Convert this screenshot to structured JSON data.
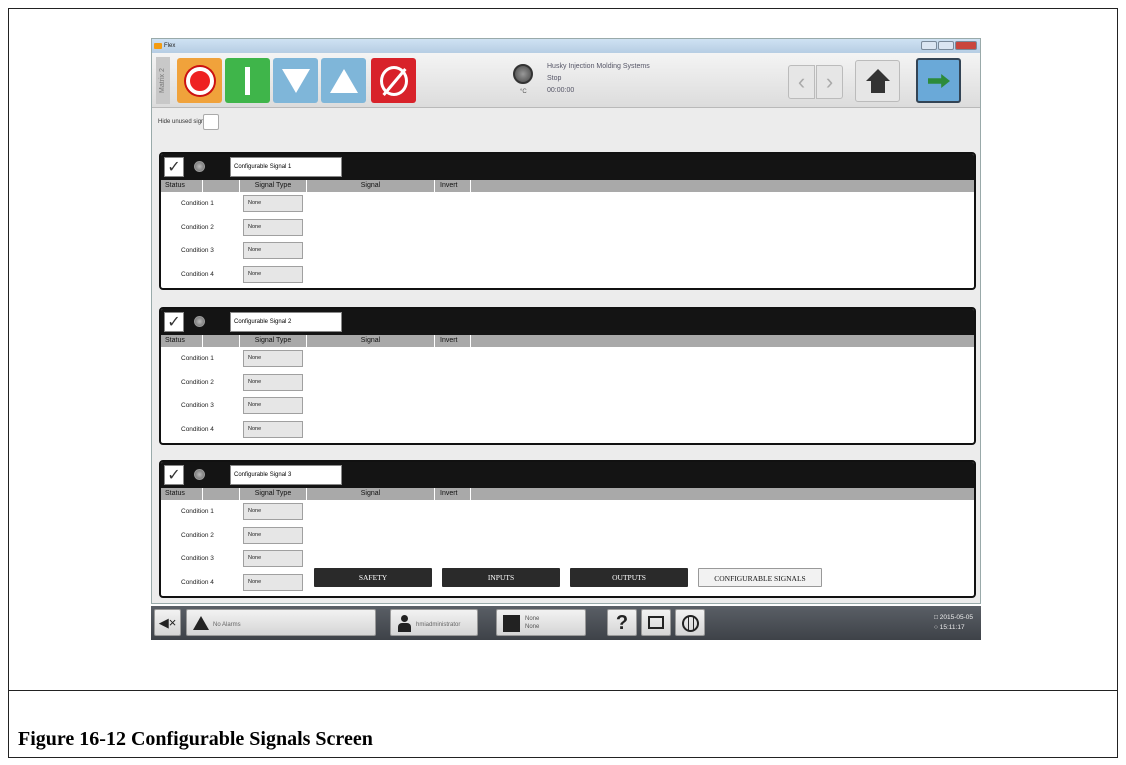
{
  "window": {
    "title": "Flex"
  },
  "toolbar": {
    "matrix_label": "Matrix 2",
    "status": {
      "company": "Husky Injection Molding Systems",
      "state": "Stop",
      "time": "00:00:00",
      "temp_unit": "°C"
    }
  },
  "hide_unused_label": "Hide unused signals",
  "columns": {
    "status": "Status",
    "signal_type": "Signal Type",
    "signal": "Signal",
    "invert": "Invert"
  },
  "panels": [
    {
      "name": "Configurable Signal 1",
      "checked": true,
      "conditions": [
        {
          "label": "Condition 1",
          "type": "None"
        },
        {
          "label": "Condition 2",
          "type": "None"
        },
        {
          "label": "Condition 3",
          "type": "None"
        },
        {
          "label": "Condition 4",
          "type": "None"
        }
      ]
    },
    {
      "name": "Configurable Signal 2",
      "checked": true,
      "conditions": [
        {
          "label": "Condition 1",
          "type": "None"
        },
        {
          "label": "Condition 2",
          "type": "None"
        },
        {
          "label": "Condition 3",
          "type": "None"
        },
        {
          "label": "Condition 4",
          "type": "None"
        }
      ]
    },
    {
      "name": "Configurable Signal 3",
      "checked": true,
      "conditions": [
        {
          "label": "Condition 1",
          "type": "None"
        },
        {
          "label": "Condition 2",
          "type": "None"
        },
        {
          "label": "Condition 3",
          "type": "None"
        },
        {
          "label": "Condition 4",
          "type": "None"
        }
      ]
    }
  ],
  "tabs": [
    {
      "label": "SAFETY",
      "active": false
    },
    {
      "label": "INPUTS",
      "active": false
    },
    {
      "label": "OUTPUTS",
      "active": false
    },
    {
      "label": "CONFIGURABLE SIGNALS",
      "active": true
    }
  ],
  "statusbar": {
    "alarms": "No Alarms",
    "user": "hmiadministrator",
    "mold_line1": "None",
    "mold_line2": "None",
    "help": "?",
    "date": "2015-05-05",
    "time": "15:11:17"
  },
  "caption": "Figure 16-12 Configurable Signals Screen"
}
